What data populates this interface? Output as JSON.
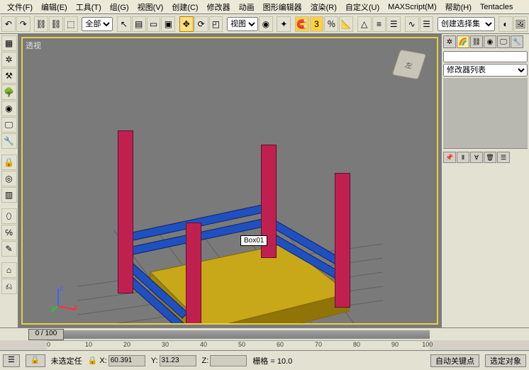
{
  "menu": {
    "file": "文件(F)",
    "edit": "编辑(E)",
    "tools": "工具(T)",
    "group": "组(G)",
    "views": "视图(V)",
    "create": "创建(C)",
    "modifiers": "修改器",
    "anim": "动画",
    "graph": "图形编辑器",
    "render": "渲染(R)",
    "customize": "自定义(U)",
    "maxscript": "MAXScript(M)",
    "help": "帮助(H)",
    "tentacles": "Tentacles"
  },
  "toolbar": {
    "selection_set_label": "全部",
    "view_btn": "视图",
    "create_sel_set": "创建选择集"
  },
  "viewport": {
    "label": "透视",
    "cube_face": "左",
    "object_label": "Box01"
  },
  "right_panel": {
    "modifier_list": "修改器列表"
  },
  "timeline": {
    "frame_display": "0 / 100",
    "ticks": [
      "0",
      "10",
      "20",
      "30",
      "40",
      "50",
      "60",
      "70",
      "80",
      "90",
      "100"
    ]
  },
  "status": {
    "not_selected": "未选定任",
    "x_val": "60.391",
    "y_val": "31.23",
    "z_val": "",
    "grid_label": "栅格 = 10.0",
    "auto_key": "自动关键点",
    "sel_obj": "选定对象"
  },
  "icons": {
    "undo": "↶",
    "redo": "↷",
    "link": "⛓",
    "unlink": "⛓",
    "bind": "⬚",
    "arrow": "↖",
    "window": "▭",
    "crossing": "▣",
    "move": "✥",
    "rotate": "⟳",
    "scale": "◰",
    "snap": "🧲",
    "angle": "📐",
    "align": "≡",
    "layers": "☰",
    "render": "🖼",
    "percent": "％",
    "mirror": "△",
    "curve": "∿"
  }
}
